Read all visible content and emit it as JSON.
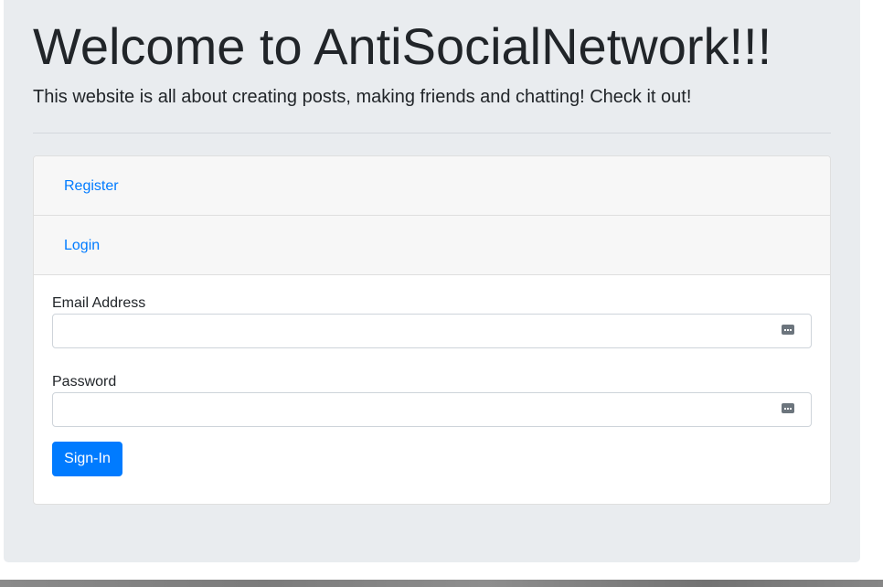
{
  "header": {
    "title": "Welcome to AntiSocialNetwork!!!",
    "subtitle": "This website is all about creating posts, making friends and chatting! Check it out!"
  },
  "nav": {
    "register_label": "Register",
    "login_label": "Login"
  },
  "form": {
    "email_label": "Email Address",
    "email_value": "",
    "password_label": "Password",
    "password_value": "",
    "submit_label": "Sign-In"
  },
  "icons": {
    "field_icon": "password-manager-key-icon"
  },
  "colors": {
    "background": "#e9ecef",
    "link": "#007bff",
    "button": "#007bff",
    "text": "#212529"
  }
}
